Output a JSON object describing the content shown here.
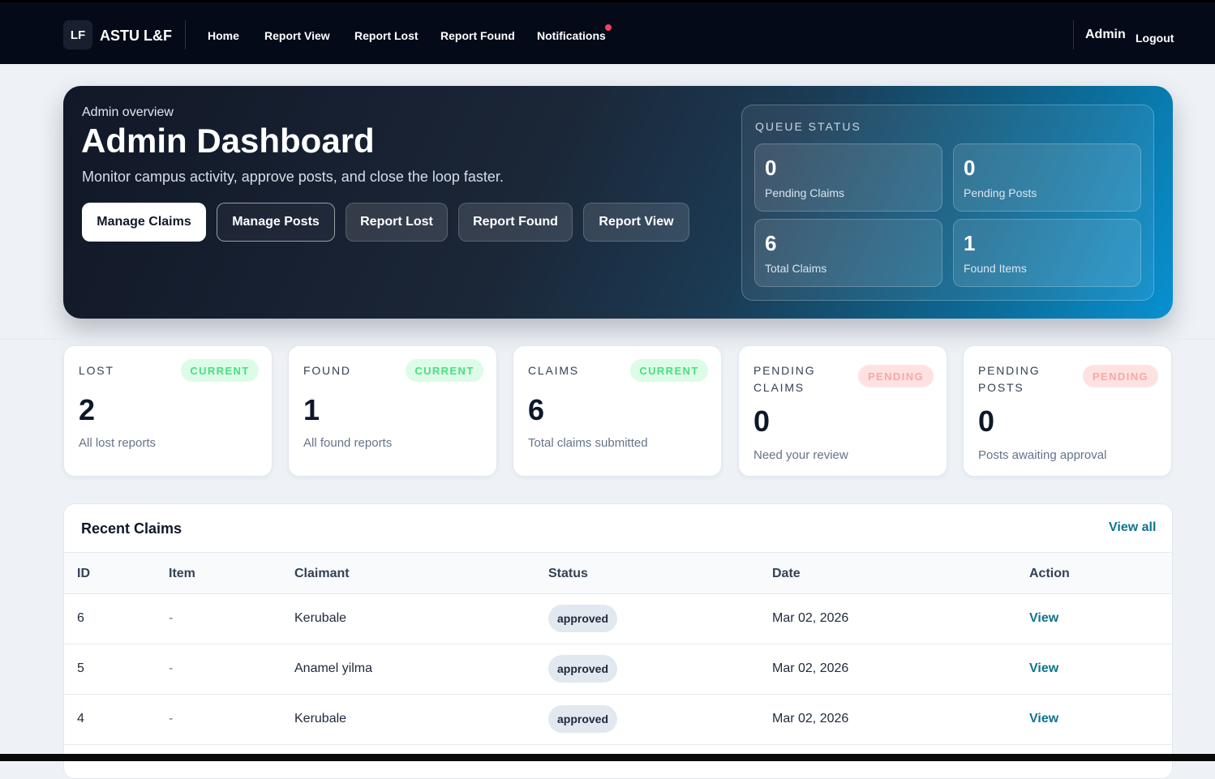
{
  "nav": {
    "logo": "LF",
    "brand": "ASTU L&F",
    "links": [
      "Home",
      "Report View",
      "Report Lost",
      "Report Found",
      "Notifications"
    ],
    "user": "Admin",
    "logout": "Logout"
  },
  "hero": {
    "kicker": "Admin overview",
    "title": "Admin Dashboard",
    "subtitle": "Monitor campus activity, approve posts, and close the loop faster.",
    "buttons": [
      "Manage Claims",
      "Manage Posts",
      "Report Lost",
      "Report Found",
      "Report View"
    ]
  },
  "queue": {
    "title": "QUEUE STATUS",
    "tiles": [
      {
        "value": "0",
        "label": "Pending Claims"
      },
      {
        "value": "0",
        "label": "Pending Posts"
      },
      {
        "value": "6",
        "label": "Total Claims"
      },
      {
        "value": "1",
        "label": "Found Items"
      }
    ]
  },
  "stats": [
    {
      "label": "LOST",
      "badge": "CURRENT",
      "value": "2",
      "desc": "All lost reports"
    },
    {
      "label": "FOUND",
      "badge": "CURRENT",
      "value": "1",
      "desc": "All found reports"
    },
    {
      "label": "CLAIMS",
      "badge": "CURRENT",
      "value": "6",
      "desc": "Total claims submitted"
    },
    {
      "label": "PENDING CLAIMS",
      "badge": "PENDING",
      "value": "0",
      "desc": "Need your review"
    },
    {
      "label": "PENDING POSTS",
      "badge": "PENDING",
      "value": "0",
      "desc": "Posts awaiting approval"
    }
  ],
  "claims": {
    "title": "Recent Claims",
    "view_all": "View all",
    "columns": [
      "ID",
      "Item",
      "Claimant",
      "Status",
      "Date",
      "Action"
    ],
    "rows": [
      {
        "id": "6",
        "item": "-",
        "claimant": "Kerubale",
        "status": "approved",
        "date": "Mar 02, 2026",
        "action": "View"
      },
      {
        "id": "5",
        "item": "-",
        "claimant": "Anamel yilma",
        "status": "approved",
        "date": "Mar 02, 2026",
        "action": "View"
      },
      {
        "id": "4",
        "item": "-",
        "claimant": "Kerubale",
        "status": "approved",
        "date": "Mar 02, 2026",
        "action": "View"
      }
    ]
  },
  "colors": {
    "navbar": "#050a18",
    "accent": "#0e7490",
    "badge_current": "#4ade80",
    "badge_pending": "#fca5a5",
    "notification_dot": "#f43f5e"
  }
}
